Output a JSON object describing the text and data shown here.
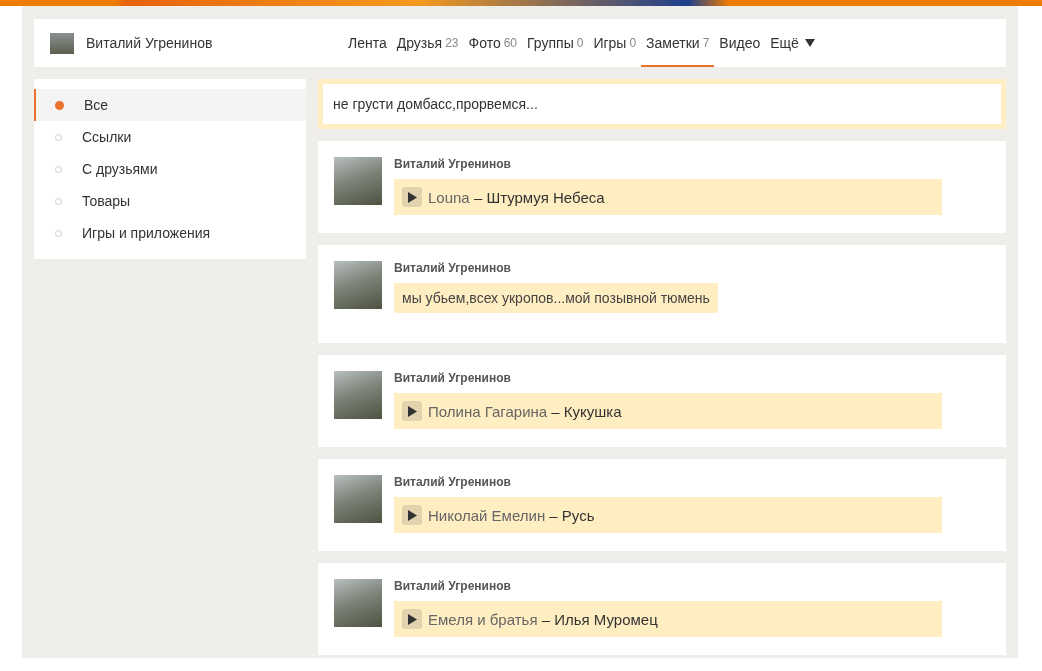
{
  "profile": {
    "name": "Виталий Угренинов"
  },
  "nav": [
    {
      "label": "Лента",
      "selected": false,
      "kind": "link"
    },
    {
      "label": "Друзья",
      "count": "23",
      "selected": false,
      "kind": "link"
    },
    {
      "label": "Фото",
      "count": "60",
      "selected": false,
      "kind": "link"
    },
    {
      "label": "Группы",
      "count": "0",
      "selected": false,
      "kind": "link"
    },
    {
      "label": "Игры",
      "count": "0",
      "selected": false,
      "kind": "link"
    },
    {
      "label": "Заметки",
      "count": "7",
      "selected": true,
      "kind": "link"
    },
    {
      "label": "Видео",
      "selected": false,
      "kind": "link"
    },
    {
      "label": "Ещё",
      "selected": false,
      "kind": "more"
    }
  ],
  "sidebar": {
    "items": [
      {
        "label": "Все",
        "selected": true
      },
      {
        "label": "Ссылки",
        "selected": false
      },
      {
        "label": "С друзьями",
        "selected": false
      },
      {
        "label": "Товары",
        "selected": false
      },
      {
        "label": "Игры и приложения",
        "selected": false
      }
    ]
  },
  "status": {
    "text": "не грусти домбасс,прорвемся..."
  },
  "posts": [
    {
      "author": "Виталий Угренинов",
      "kind": "music",
      "artist": "Louna",
      "title": "– Штурмуя Небеса"
    },
    {
      "author": "Виталий Угренинов",
      "kind": "text",
      "text": "мы убьем,всех укропов...мой позывной тюмень"
    },
    {
      "author": "Виталий Угренинов",
      "kind": "music",
      "artist": "Полина Гагарина",
      "title": "– Кукушка"
    },
    {
      "author": "Виталий Угренинов",
      "kind": "music",
      "artist": "Николай Емелин",
      "title": "– Русь"
    },
    {
      "author": "Виталий Угренинов",
      "kind": "music",
      "artist": "Емеля и братья",
      "title": "– Илья Муромец"
    }
  ]
}
